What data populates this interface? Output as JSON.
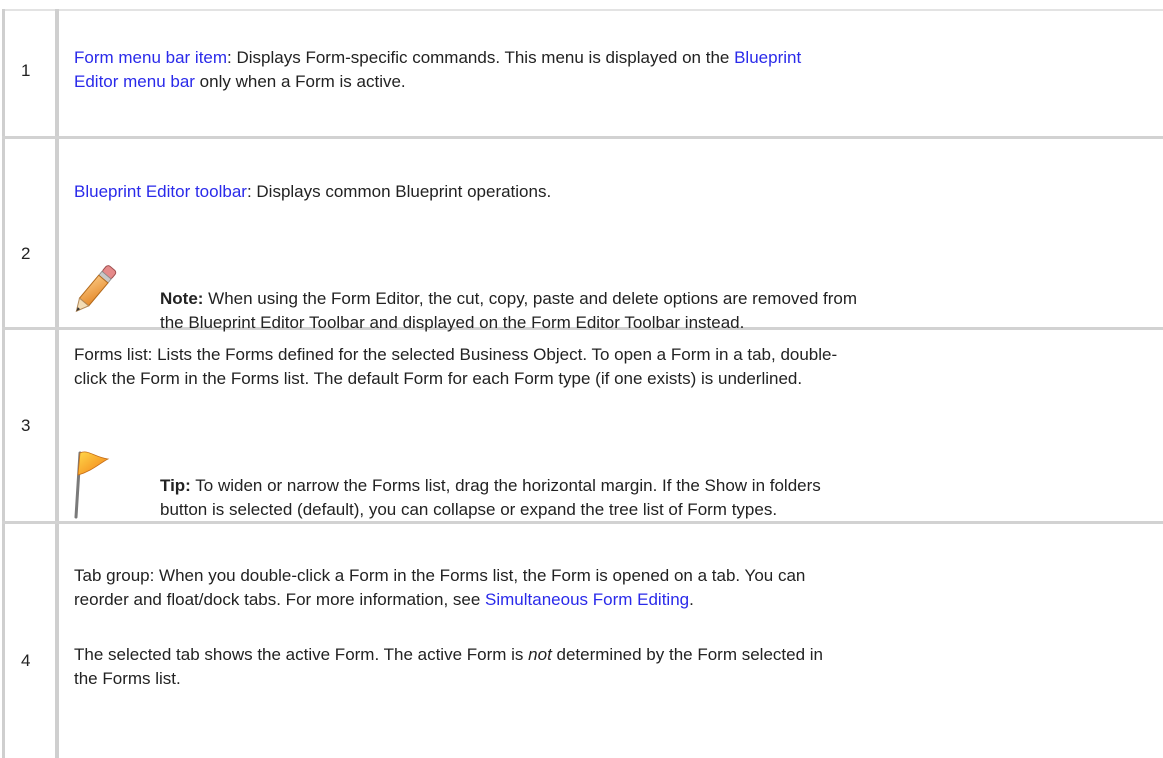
{
  "rows": [
    {
      "number": "1",
      "link1": "Form menu bar item",
      "text1": ": Displays Form-specific commands. This menu is displayed on the ",
      "link2_a": "Blueprint",
      "link2_b": "Editor menu bar",
      "text2": " only when a Form is active."
    },
    {
      "number": "2",
      "link1": "Blueprint Editor toolbar",
      "text1": ": Displays common Blueprint operations.",
      "note_label": "Note:",
      "note_line1": " When using the Form Editor, the cut, copy, paste and delete options are removed from",
      "note_line2": "the Blueprint Editor Toolbar and displayed on the Form Editor Toolbar instead.",
      "icon": "pencil-icon"
    },
    {
      "number": "3",
      "line1": "Forms list: Lists the Forms defined for the selected Business Object. To open a Form in a tab, double-",
      "line2": "click the Form in the Forms list. The default Form for each Form type (if one exists) is underlined.",
      "tip_label": "Tip:",
      "tip_line1": " To widen or narrow the Forms list, drag the horizontal margin. If the Show in folders",
      "tip_line2": "button is selected (default), you can collapse or expand the tree list of Form types.",
      "icon": "flag-icon"
    },
    {
      "number": "4",
      "line1": "Tab group: When you double-click a Form in the Forms list, the Form is opened on a tab. You can",
      "line2_text": "reorder and float/dock tabs. For more information, see ",
      "line2_link": "Simultaneous Form Editing",
      "line2_end": ".",
      "line3_a": "The selected tab shows the active Form. The active Form is ",
      "line3_em": "not",
      "line3_b": " determined by the Form selected in",
      "line4": "the Forms list."
    }
  ],
  "colors": {
    "link": "#2a2aea",
    "border": "#cfcfcf",
    "text": "#222222"
  }
}
